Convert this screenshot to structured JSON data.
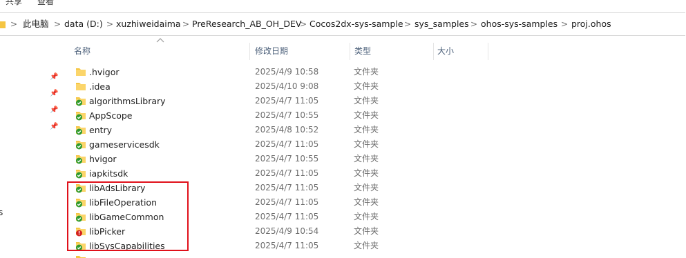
{
  "ribbon": {
    "tabs": [
      "共享",
      "查看"
    ]
  },
  "address": {
    "crumbs": [
      "此电脑",
      "data (D:)",
      "xuzhiweidaima",
      "PreResearch_AB_OH_DEV",
      "Cocos2dx-sys-sample",
      "sys_samples",
      "ohos-sys-samples",
      "proj.ohos"
    ],
    "separator": ">"
  },
  "nav": {
    "partial_label": "s"
  },
  "columns": {
    "name": "名称",
    "modified": "修改日期",
    "type": "类型",
    "size": "大小"
  },
  "colors": {
    "sync_ok": "#2e9a2e",
    "sync_error": "#d32020",
    "folder": "#f5c542",
    "highlight": "#e0101a"
  },
  "files": [
    {
      "name": ".hvigor",
      "modified": "2025/4/9 10:58",
      "type": "文件夹",
      "icon": "folder-icon"
    },
    {
      "name": ".idea",
      "modified": "2025/4/10 9:08",
      "type": "文件夹",
      "icon": "folder-icon"
    },
    {
      "name": "algorithmsLibrary",
      "modified": "2025/4/7 11:05",
      "type": "文件夹",
      "icon": "synced-folder-icon"
    },
    {
      "name": "AppScope",
      "modified": "2025/4/7 10:55",
      "type": "文件夹",
      "icon": "synced-folder-icon"
    },
    {
      "name": "entry",
      "modified": "2025/4/8 10:52",
      "type": "文件夹",
      "icon": "synced-folder-icon"
    },
    {
      "name": "gameservicesdk",
      "modified": "2025/4/7 11:05",
      "type": "文件夹",
      "icon": "synced-folder-icon"
    },
    {
      "name": "hvigor",
      "modified": "2025/4/7 10:55",
      "type": "文件夹",
      "icon": "synced-folder-icon"
    },
    {
      "name": "iapkitsdk",
      "modified": "2025/4/7 11:05",
      "type": "文件夹",
      "icon": "synced-folder-icon"
    },
    {
      "name": "libAdsLibrary",
      "modified": "2025/4/7 11:05",
      "type": "文件夹",
      "icon": "synced-folder-icon"
    },
    {
      "name": "libFileOperation",
      "modified": "2025/4/7 11:05",
      "type": "文件夹",
      "icon": "synced-folder-icon"
    },
    {
      "name": "libGameCommon",
      "modified": "2025/4/7 11:05",
      "type": "文件夹",
      "icon": "synced-folder-icon"
    },
    {
      "name": "libPicker",
      "modified": "2025/4/9 10:54",
      "type": "文件夹",
      "icon": "sync-error-folder-icon"
    },
    {
      "name": "libSysCapabilities",
      "modified": "2025/4/7 11:05",
      "type": "文件夹",
      "icon": "synced-folder-icon"
    }
  ]
}
